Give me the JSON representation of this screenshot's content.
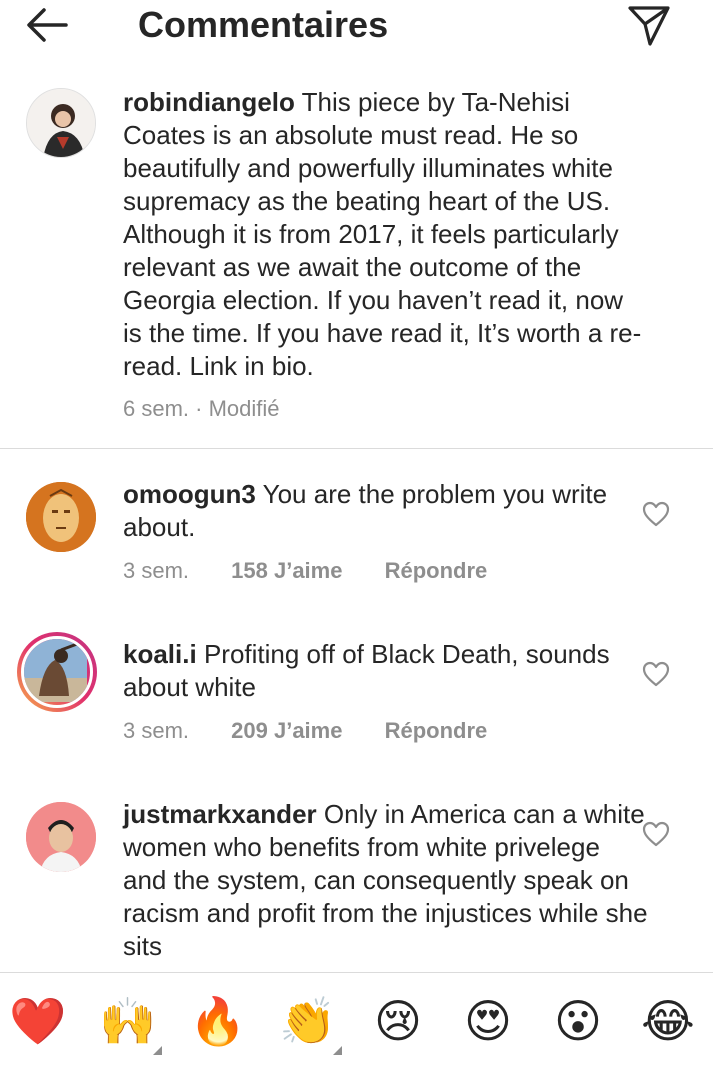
{
  "header": {
    "title": "Commentaires"
  },
  "caption": {
    "username": "robindiangelo",
    "text": "This piece by Ta-Nehisi Coates is an absolute must read. He so beautifully and powerfully illuminates white supremacy as the beating heart of the US. Although it is from 2017, it feels particularly relevant as we await the outcome of the Georgia election. If you haven’t read it, now is the time. If you have read it, It’s worth a re-read. Link in bio.",
    "meta": "6 sem. · Modifié"
  },
  "comments": [
    {
      "username": "omoogun3",
      "text": "You are the problem you write about.",
      "time": "3 sem.",
      "likes": "158 J’aime",
      "reply": "Répondre"
    },
    {
      "username": "koali.i",
      "text": "Profiting off of Black Death, sounds about white",
      "time": "3 sem.",
      "likes": "209 J’aime",
      "reply": "Répondre"
    },
    {
      "username": "justmarkxander",
      "text": "Only in America can a white women who benefits from white privelege and the system, can consequently speak on racism and profit from the injustices while she sits"
    }
  ],
  "emoji_bar": [
    {
      "glyph": "❤️",
      "icon": "red-heart"
    },
    {
      "glyph": "🙌",
      "icon": "raising-hands"
    },
    {
      "glyph": "🔥",
      "icon": "fire"
    },
    {
      "glyph": "👏",
      "icon": "clapping-hands"
    },
    {
      "glyph": "😢",
      "icon": "crying-face"
    },
    {
      "glyph": "😍",
      "icon": "heart-eyes-face"
    },
    {
      "glyph": "😮",
      "icon": "surprised-face"
    },
    {
      "glyph": "😂",
      "icon": "tears-of-joy-face"
    }
  ],
  "colors": {
    "text": "#262626",
    "secondary": "#8e8e8e",
    "divider": "#dbdbdb",
    "story_ring_start": "#f7b14a",
    "story_ring_end": "#c13584"
  }
}
